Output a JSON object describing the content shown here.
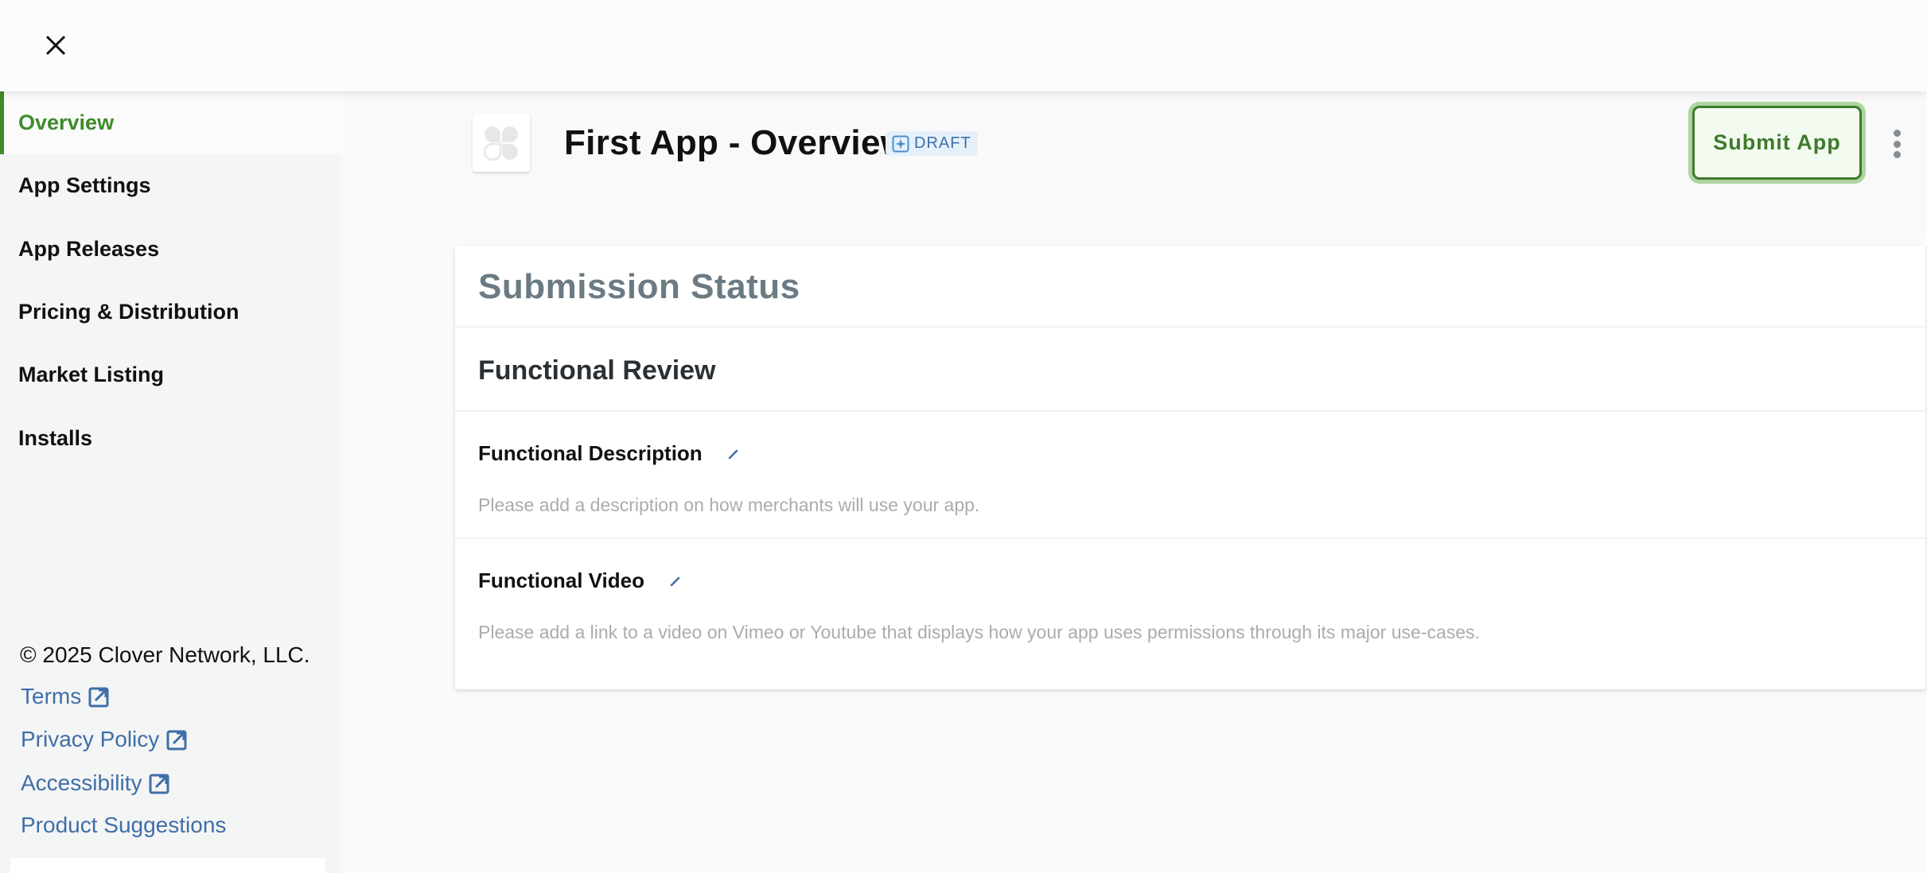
{
  "topbar": {
    "close_icon": "close-icon"
  },
  "sidebar": {
    "items": [
      {
        "label": "Overview",
        "active": true
      },
      {
        "label": "App Settings",
        "active": false
      },
      {
        "label": "App Releases",
        "active": false
      },
      {
        "label": "Pricing & Distribution",
        "active": false
      },
      {
        "label": "Market Listing",
        "active": false
      },
      {
        "label": "Installs",
        "active": false
      }
    ],
    "footer": {
      "copyright": "© 2025 Clover Network, LLC.",
      "links": [
        {
          "label": "Terms",
          "icon": "external-link-icon"
        },
        {
          "label": "Privacy Policy",
          "icon": "external-link-icon"
        },
        {
          "label": "Accessibility",
          "icon": "external-link-icon"
        },
        {
          "label": "Product Suggestions",
          "icon": null
        }
      ]
    }
  },
  "header": {
    "app_icon": "clover-logo-icon",
    "title": "First App - Overview",
    "status_badge": {
      "label": "DRAFT",
      "icon": "sparkle-icon"
    },
    "submit_label": "Submit App",
    "more_icon": "kebab-menu-icon"
  },
  "card": {
    "title": "Submission Status",
    "section_title": "Functional Review",
    "fields": [
      {
        "label": "Functional Description",
        "placeholder": "Please add a description on how merchants will use your app.",
        "edit_icon": "pencil-icon"
      },
      {
        "label": "Functional Video",
        "placeholder": "Please add a link to a video on Vimeo or Youtube that displays how your app uses permissions through its major use-cases.",
        "edit_icon": "pencil-icon"
      }
    ]
  },
  "colors": {
    "accent_green": "#3f8a2a",
    "link_blue": "#3f6fa8",
    "sidebar_bg": "#f4f5f5",
    "badge_bg": "#e6f0fa"
  }
}
